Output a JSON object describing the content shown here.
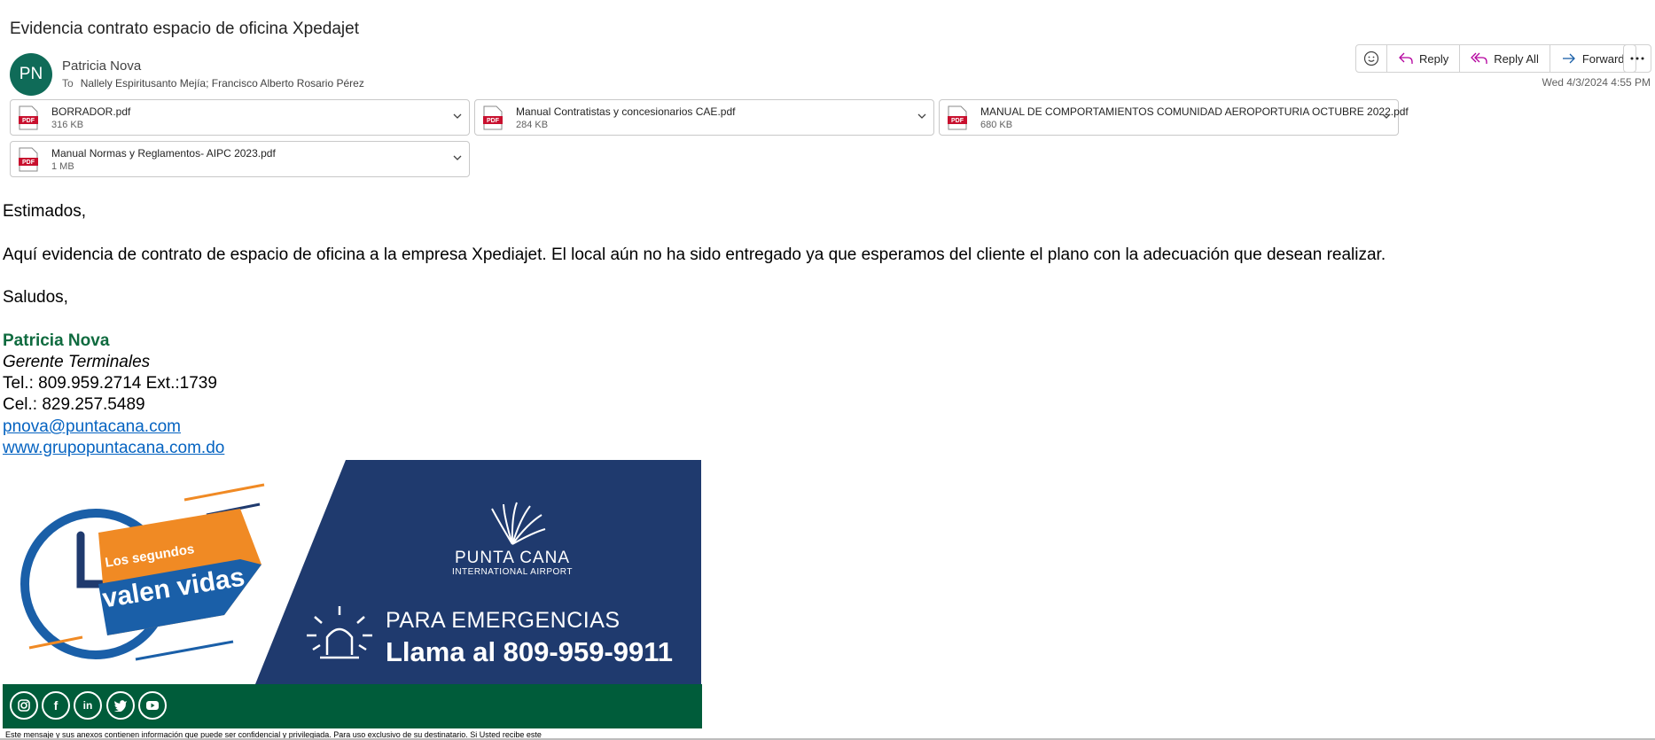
{
  "subject": "Evidencia contrato espacio de oficina Xpedajet",
  "sender": {
    "initials": "PN",
    "name": "Patricia Nova",
    "avatar_color": "#0f6b58"
  },
  "recipients": {
    "label": "To",
    "list": "Nallely Espiritusanto Mejía; Francisco Alberto Rosario Pérez"
  },
  "toolbar": {
    "reply": "Reply",
    "reply_all": "Reply All",
    "forward": "Forward"
  },
  "date": "Wed 4/3/2024 4:55 PM",
  "attachments": [
    {
      "name": "BORRADOR.pdf",
      "size": "316 KB",
      "type": "pdf"
    },
    {
      "name": "Manual Contratistas y concesionarios CAE.pdf",
      "size": "284 KB",
      "type": "pdf"
    },
    {
      "name": "MANUAL DE COMPORTAMIENTOS COMUNIDAD AEROPORTURIA OCTUBRE 2022.pdf",
      "size": "680 KB",
      "type": "pdf"
    },
    {
      "name": "Manual Normas y Reglamentos- AIPC 2023.pdf",
      "size": "1 MB",
      "type": "pdf"
    }
  ],
  "body": {
    "greeting": "Estimados,",
    "paragraph": "Aquí evidencia de contrato de espacio de oficina a la empresa Xpediajet. El local aún no ha sido entregado ya que esperamos del cliente el plano con la adecuación que desean realizar.",
    "closing": "Saludos,"
  },
  "signature": {
    "name": "Patricia Nova",
    "title": "Gerente Terminales",
    "tel": "Tel.: 809.959.2714 Ext.:1739",
    "cel": "Cel.: 829.257.5489",
    "email": "pnova@puntacana.com",
    "website": "www.grupopuntacana.com.do",
    "name_color": "#0f6b3f"
  },
  "banner": {
    "tagline_top": "Los segundos",
    "tagline_bottom": "valen vidas",
    "airport_name": "PUNTA CANA",
    "airport_sub": "INTERNATIONAL AIRPORT",
    "emergency_title": "PARA EMERGENCIAS",
    "emergency_phone": "Llama al 809-959-9911",
    "navy": "#1f3a6e",
    "orange": "#f08a24",
    "blue": "#1a5fa8"
  },
  "social_icons": [
    "instagram-icon",
    "facebook-icon",
    "linkedin-icon",
    "twitter-icon",
    "youtube-icon"
  ],
  "disclaimer": "Este mensaje y sus anexos contienen información que puede ser confidencial y privilegiada. Para uso exclusivo de su destinatario. Si Usted recibe este"
}
